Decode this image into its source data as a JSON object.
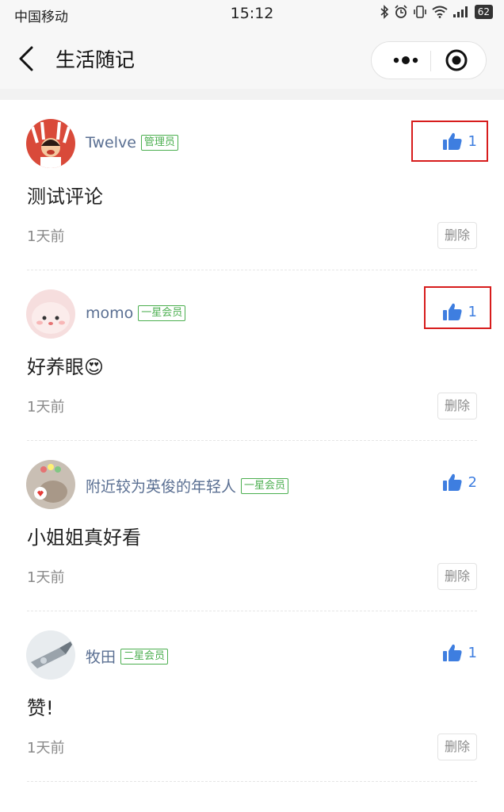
{
  "status_bar": {
    "carrier": "中国移动",
    "time": "15:12",
    "battery": "62"
  },
  "nav": {
    "title": "生活随记"
  },
  "comments": [
    {
      "user": "Twelve",
      "badge": "管理员",
      "likes": "1",
      "text": "测试评论",
      "time": "1天前",
      "delete_label": "删除"
    },
    {
      "user": "momo",
      "badge": "一星会员",
      "likes": "1",
      "text": "好养眼😍",
      "time": "1天前",
      "delete_label": "删除"
    },
    {
      "user": "附近较为英俊的年轻人",
      "badge": "一星会员",
      "likes": "2",
      "text": "小姐姐真好看",
      "time": "1天前",
      "delete_label": "删除"
    },
    {
      "user": "牧田",
      "badge": "二星会员",
      "likes": "1",
      "text": "赞!",
      "time": "1天前",
      "delete_label": "删除"
    }
  ],
  "colors": {
    "like_blue": "#3e7ee0",
    "badge_green": "#4caf50",
    "name_blue": "#5a6f92",
    "highlight_red": "#d71c1c"
  },
  "icons": [
    "back-arrow-icon",
    "more-dots-icon",
    "target-icon",
    "thumbs-up-icon",
    "bluetooth-icon",
    "alarm-icon",
    "vibrate-icon",
    "wifi-icon",
    "signal-icon"
  ]
}
